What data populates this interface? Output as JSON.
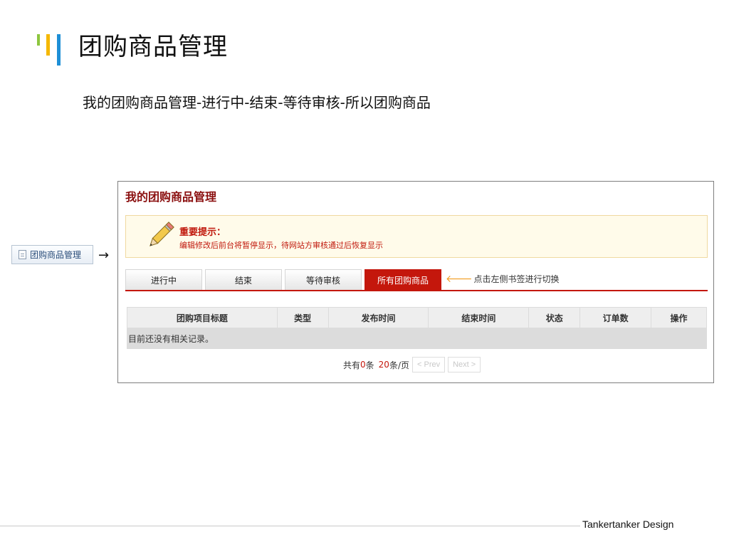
{
  "slide": {
    "title": "团购商品管理",
    "subtitle": "我的团购商品管理-进行中-结束-等待审核-所以团购商品",
    "footer": "Tankertanker Design"
  },
  "nav": {
    "item_label": "团购商品管理",
    "arrow": "→"
  },
  "panel": {
    "title": "我的团购商品管理",
    "notice": {
      "heading": "重要提示：",
      "body": "编辑修改后前台将暂停显示，待网站方审核通过后恢复显示",
      "icon": "pencil-icon"
    },
    "tabs": [
      {
        "label": "进行中",
        "active": false
      },
      {
        "label": "结束",
        "active": false
      },
      {
        "label": "等待审核",
        "active": false
      },
      {
        "label": "所有团购商品",
        "active": true
      }
    ],
    "tab_hint": "点击左侧书签进行切换",
    "table": {
      "columns": [
        "团购项目标题",
        "类型",
        "发布时间",
        "结束时间",
        "状态",
        "订单数",
        "操作"
      ],
      "empty_text": "目前还没有相关记录。"
    },
    "pager": {
      "total_prefix": "共有",
      "total": "0",
      "total_suffix": "条",
      "per_page": "20",
      "per_page_suffix": "条/页",
      "prev": "< Prev",
      "next": "Next >"
    }
  },
  "colors": {
    "accent": "#c4170c",
    "notice_bg": "#fffbea",
    "deco_green": "#8dc63f",
    "deco_yellow": "#f5b800",
    "deco_blue": "#1e8fd6"
  }
}
